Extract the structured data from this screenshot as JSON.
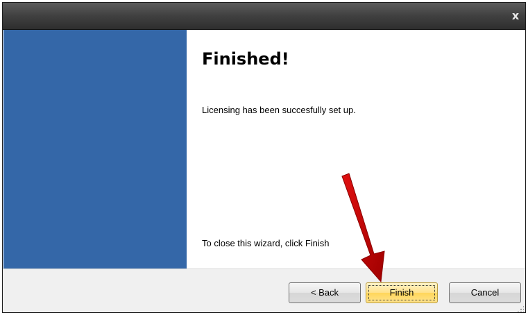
{
  "window": {
    "close_label": "x"
  },
  "content": {
    "heading": "Finished!",
    "message": "Licensing has been succesfully set up.",
    "close_hint": "To close this wizard, click Finish"
  },
  "buttons": {
    "back": "< Back",
    "finish": "Finish",
    "cancel": "Cancel"
  },
  "colors": {
    "side_panel": "#3467a8",
    "finish_button": "#ffd659",
    "annotation_arrow": "#c00000"
  },
  "icons": {
    "close": "close-icon",
    "annotation": "annotation-arrow"
  }
}
